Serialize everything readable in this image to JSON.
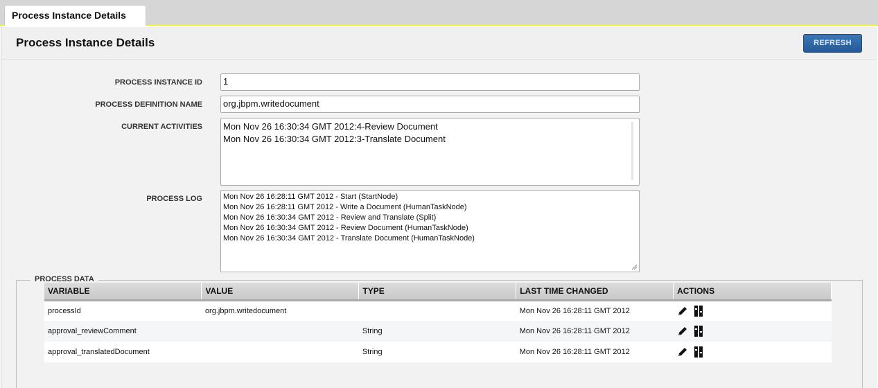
{
  "tab": {
    "label": "Process Instance Details"
  },
  "header": {
    "title": "Process Instance Details",
    "refresh_label": "REFRESH"
  },
  "form": {
    "instance_id_label": "PROCESS INSTANCE ID",
    "instance_id_value": "1",
    "definition_label": "PROCESS DEFINITION NAME",
    "definition_value": "org.jbpm.writedocument",
    "activities_label": "CURRENT ACTIVITIES",
    "activities": [
      "Mon Nov 26 16:30:34 GMT 2012:4-Review Document",
      "Mon Nov 26 16:30:34 GMT 2012:3-Translate Document"
    ],
    "log_label": "PROCESS LOG",
    "log": [
      "Mon Nov 26 16:28:11 GMT 2012 - Start (StartNode)",
      "Mon Nov 26 16:28:11 GMT 2012 - Write a Document (HumanTaskNode)",
      "Mon Nov 26 16:30:34 GMT 2012 - Review and Translate (Split)",
      "Mon Nov 26 16:30:34 GMT 2012 - Review Document (HumanTaskNode)",
      "Mon Nov 26 16:30:34 GMT 2012 - Translate Document (HumanTaskNode)"
    ]
  },
  "process_data": {
    "legend": "PROCESS DATA",
    "columns": [
      "VARIABLE",
      "VALUE",
      "TYPE",
      "LAST TIME CHANGED",
      "ACTIONS"
    ],
    "rows": [
      {
        "variable": "processId",
        "value": "org.jbpm.writedocument",
        "type": "",
        "changed": "Mon Nov 26 16:28:11 GMT 2012"
      },
      {
        "variable": "approval_reviewComment",
        "value": "",
        "type": "String",
        "changed": "Mon Nov 26 16:28:11 GMT 2012"
      },
      {
        "variable": "approval_translatedDocument",
        "value": "",
        "type": "String",
        "changed": "Mon Nov 26 16:28:11 GMT 2012"
      }
    ],
    "action_icons": [
      "pencil-icon",
      "history-icon"
    ]
  },
  "colors": {
    "accent_bar": "#e8ef3a",
    "button": "#2f67a6"
  }
}
